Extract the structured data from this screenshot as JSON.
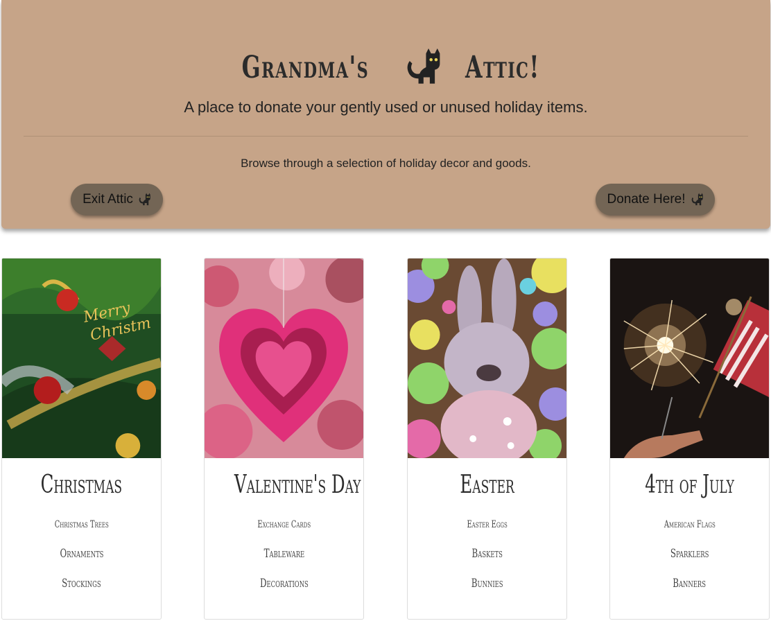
{
  "header": {
    "title_left": "Grandma's",
    "title_right": "Attic!",
    "title_icon": "cat-icon",
    "subtitle": "A place to donate your gently used or unused holiday items.",
    "browse_text": "Browse through a selection of holiday decor and goods.",
    "exit_button": "Exit Attic",
    "donate_button": "Donate Here!",
    "background_color": "#c6a488",
    "button_color": "#736555"
  },
  "cards": [
    {
      "title": "Christmas",
      "items": [
        "Christmas Trees",
        "Ornaments",
        "Stockings"
      ],
      "image": "christmas-tree-photo"
    },
    {
      "title": "Valentine's Day",
      "items": [
        "Exchange Cards",
        "Tableware",
        "Decorations"
      ],
      "image": "pink-heart-photo"
    },
    {
      "title": "Easter",
      "items": [
        "Easter Eggs",
        "Baskets",
        "Bunnies"
      ],
      "image": "plush-bunny-photo"
    },
    {
      "title": "4th of July",
      "items": [
        "American Flags",
        "Sparklers",
        "Banners"
      ],
      "image": "sparkler-flag-photo"
    }
  ]
}
